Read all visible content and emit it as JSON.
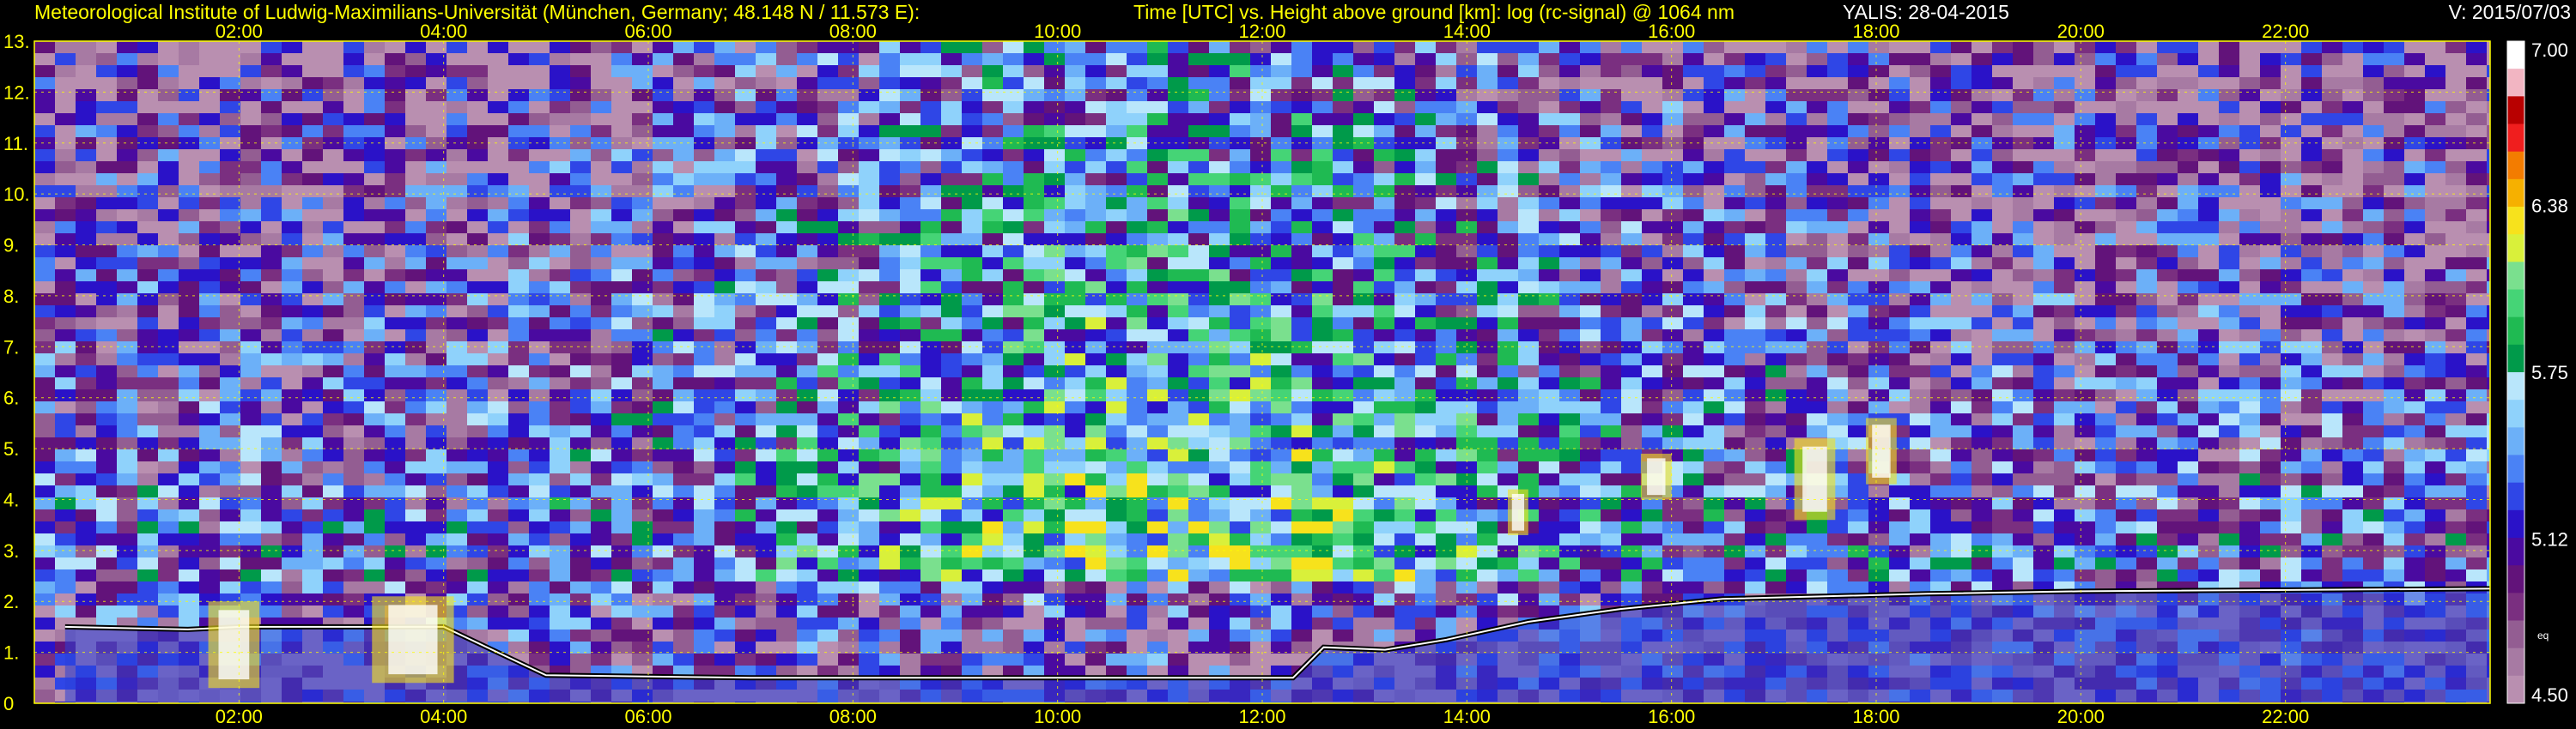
{
  "header": {
    "institute": "Meteorological Institute of Ludwig-Maximilians-Universität (München, Germany; 48.148 N / 11.573 E):",
    "plot_description": "Time [UTC] vs. Height above ground [km]: log (rc-signal) @ 1064 nm",
    "instrument_date": "YALIS: 28-04-2015",
    "version": "V: 2015/07/03"
  },
  "chart_data": {
    "type": "heatmap",
    "title": "Time [UTC] vs. Height above ground [km]: log (rc-signal) @ 1064 nm",
    "x_ticks": [
      "02:00",
      "04:00",
      "06:00",
      "08:00",
      "10:00",
      "12:00",
      "14:00",
      "16:00",
      "18:00",
      "20:00",
      "22:00"
    ],
    "x_tick_hours": [
      2,
      4,
      6,
      8,
      10,
      12,
      14,
      16,
      18,
      20,
      22
    ],
    "xlim": [
      0,
      24
    ],
    "y_ticks": [
      "0",
      "1.",
      "2.",
      "3.",
      "4.",
      "5.",
      "6.",
      "7.",
      "8.",
      "9.",
      "10.",
      "11.",
      "12.",
      "13."
    ],
    "y_tick_values": [
      0,
      1,
      2,
      3,
      4,
      5,
      6,
      7,
      8,
      9,
      10,
      11,
      12,
      13
    ],
    "ylim": [
      0,
      13
    ],
    "grid": true,
    "colorbar": {
      "ticks": [
        "7.00",
        "6.38",
        "5.75",
        "5.12",
        "4.50"
      ],
      "tick_values": [
        7.0,
        6.38,
        5.75,
        5.12,
        4.5
      ],
      "range": [
        4.5,
        7.0
      ],
      "unit_label": "eq",
      "colors": [
        "#b98fb0",
        "#a77aa3",
        "#935d92",
        "#7a2f80",
        "#62137a",
        "#4a0aa0",
        "#2a12c8",
        "#2f46e6",
        "#4a82f5",
        "#6cb0f8",
        "#8fd2fb",
        "#b9e6fb",
        "#009a4a",
        "#1fba52",
        "#45d476",
        "#7ae08e",
        "#d9f03a",
        "#f7e21c",
        "#f6b000",
        "#f37c00",
        "#f01e1e",
        "#b80000",
        "#f2b5c2",
        "#ffffff"
      ]
    },
    "features": [
      {
        "name": "boundary layer top",
        "points": [
          [
            0.3,
            1.5
          ],
          [
            1.5,
            1.45
          ],
          [
            2.0,
            1.5
          ],
          [
            4.0,
            1.5
          ],
          [
            5.0,
            0.55
          ],
          [
            7.0,
            0.5
          ],
          [
            10.0,
            0.5
          ],
          [
            12.3,
            0.5
          ],
          [
            12.6,
            1.1
          ],
          [
            13.2,
            1.05
          ],
          [
            13.8,
            1.25
          ],
          [
            14.6,
            1.6
          ],
          [
            15.5,
            1.85
          ],
          [
            16.5,
            2.05
          ],
          [
            17.5,
            2.1
          ],
          [
            18.5,
            2.15
          ],
          [
            20.0,
            2.2
          ],
          [
            24.0,
            2.25
          ]
        ]
      },
      {
        "name": "cloud 1",
        "x": [
          1.7,
          2.2
        ],
        "y": [
          0.3,
          2.0
        ]
      },
      {
        "name": "cloud 2",
        "x": [
          3.3,
          4.1
        ],
        "y": [
          0.4,
          2.1
        ]
      },
      {
        "name": "upper cloud 1",
        "x": [
          14.4,
          14.6
        ],
        "y": [
          3.3,
          4.2
        ]
      },
      {
        "name": "upper cloud 2",
        "x": [
          15.7,
          16.0
        ],
        "y": [
          4.0,
          4.9
        ]
      },
      {
        "name": "upper cloud 3",
        "x": [
          17.2,
          17.6
        ],
        "y": [
          3.6,
          5.2
        ]
      },
      {
        "name": "upper cloud 4",
        "x": [
          17.9,
          18.2
        ],
        "y": [
          4.3,
          5.6
        ]
      }
    ]
  }
}
